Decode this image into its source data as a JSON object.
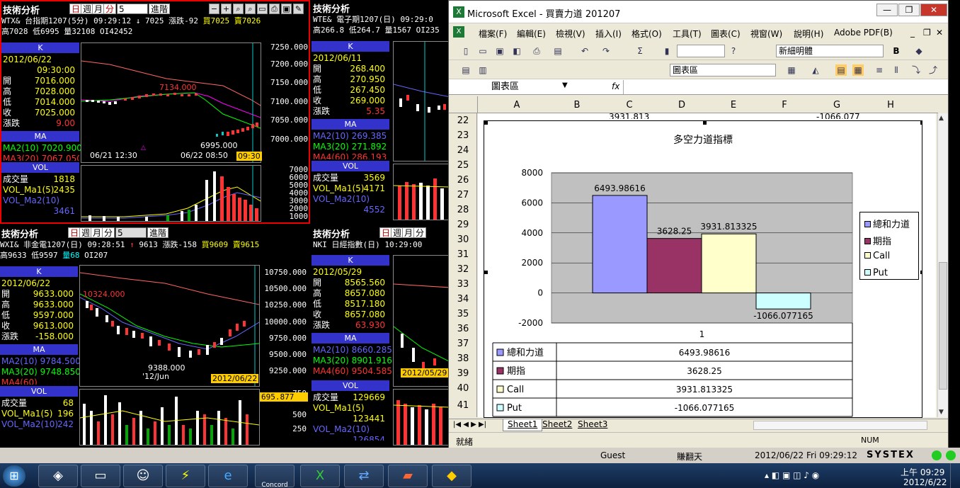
{
  "panels": [
    {
      "title": "技術分析",
      "symbol": "WTX&",
      "name": "台指期1207(5分)",
      "time": "09:29:12",
      "arrow": "↓",
      "price": "7025",
      "change": "漲跌-92",
      "bid": "買7025",
      "ask": "賣7026",
      "high": "高7028",
      "low": "低6995",
      "vol": "量32108",
      "oi": "OI42452",
      "date": "2012/06/22",
      "clock": "09:30:00",
      "open": "7016.000",
      "hi": "7028.000",
      "lo": "7014.000",
      "close": "7025.000",
      "diff": "9.00",
      "ma1": "MA2(10) 7020.900",
      "ma2": "MA3(20) 7067.050",
      "vol_total": "1818",
      "vma1": "2435",
      "vma2": "3461",
      "scale": [
        "7250.000",
        "7200.000",
        "7150.000",
        "7100.000",
        "7050.000",
        "7000.000"
      ],
      "vscale": [
        "7000",
        "6000",
        "5000",
        "4000",
        "3000",
        "2000",
        "1000"
      ],
      "ann_hi": "7134.000",
      "ann_lo": "6995.000",
      "x1": "06/21 12:30",
      "x2": "06/22 08:50",
      "xcur": "09:30",
      "period": "5"
    },
    {
      "title": "技術分析",
      "symbol": "WTE&",
      "name": "電子期1207(日)",
      "time": "09:29:0",
      "high": "高266.8",
      "low": "低264.7",
      "vol": "量1567",
      "oi": "OI235",
      "date": "2012/06/11",
      "open": "268.400",
      "hi": "270.950",
      "lo": "267.450",
      "close": "269.000",
      "diff": "5.35",
      "ma1": "MA2(10) 269.385",
      "ma2": "MA3(20) 271.892",
      "ma3": "MA4(60) 286.193",
      "vol_total": "3569",
      "vma1": "4171",
      "vma2": "4552"
    },
    {
      "title": "技術分析",
      "symbol": "WXI&",
      "name": "非金電1207(日)",
      "time": "09:28:51",
      "arrow": "↑",
      "price": "9613",
      "change": "漲跌-158",
      "bid": "買9609",
      "ask": "賣9615",
      "high": "高9633",
      "low": "低9597",
      "vol": "量68",
      "oi": "OI207",
      "date": "2012/06/22",
      "open": "9633.000",
      "hi": "9633.000",
      "lo": "9597.000",
      "close": "9613.000",
      "diff": "-158.000",
      "ma1": "MA2(10) 9784.500",
      "ma2": "MA3(20) 9748.850",
      "ma3": "MA4(60)",
      "vol_total": "68",
      "vma1": "196",
      "vma2": "242",
      "scale": [
        "10750.000",
        "10500.000",
        "10250.000",
        "10000.000",
        "9750.000",
        "9500.000",
        "9250.000"
      ],
      "vscale": [
        "750",
        "695.877",
        "500",
        "250"
      ],
      "ann_hi": "10324.000",
      "ann_lo": "9388.000",
      "x1": "'12/Jun",
      "xcur": "2012/06/22",
      "period": "5"
    },
    {
      "title": "技術分析",
      "symbol": "NKI",
      "name": "日經指數(日)",
      "time": "10:29:00",
      "date": "2012/05/29",
      "open": "8565.560",
      "hi": "8657.080",
      "lo": "8517.180",
      "close": "8657.080",
      "diff": "63.930",
      "ma1": "MA2(10) 8660.285",
      "ma2": "MA3(20) 8901.916",
      "ma3": "MA4(60) 9504.585",
      "vol_total": "129669",
      "vma1": "123441",
      "vma2": "126854",
      "xcur": "2012/05/29"
    }
  ],
  "labels": {
    "day": "日",
    "week": "週",
    "month": "月",
    "min": "分",
    "adv": "進階",
    "k": "K",
    "ma": "MA",
    "vol": "VOL",
    "open": "開",
    "high": "高",
    "low": "低",
    "close": "收",
    "diff": "漲跌",
    "voltotal": "成交量",
    "vma1": "VOL_Ma1(5)",
    "vma2": "VOL_Ma2(10)"
  },
  "excel": {
    "title": "Microsoft Excel - 買賣力道 201207",
    "menu": [
      "檔案(F)",
      "編輯(E)",
      "檢視(V)",
      "插入(I)",
      "格式(O)",
      "工具(T)",
      "圖表(C)",
      "視窗(W)",
      "說明(H)",
      "Adobe PDF(B)"
    ],
    "font": "新細明體",
    "chart_sel": "圖表區",
    "namebox": "圖表區",
    "fx": "fx",
    "cols": [
      "A",
      "B",
      "C",
      "D",
      "E",
      "F",
      "G",
      "H"
    ],
    "rows": [
      "22",
      "23",
      "24",
      "25",
      "26",
      "27",
      "28",
      "29",
      "30",
      "31",
      "32",
      "33",
      "34",
      "35",
      "36",
      "37",
      "38",
      "39",
      "40",
      "41"
    ],
    "hidden_c22": "3931.813",
    "hidden_g22": "-1066.077",
    "tabs": [
      "Sheet1",
      "Sheet2",
      "Sheet3"
    ],
    "status_left": "就緒",
    "status_right": "NUM"
  },
  "chart_data": {
    "type": "bar",
    "title": "多空力道指標",
    "categories": [
      "1"
    ],
    "series": [
      {
        "name": "總和力道",
        "values": [
          6493.98616
        ],
        "color": "#9999ff"
      },
      {
        "name": "期指",
        "values": [
          3628.25
        ],
        "color": "#993366"
      },
      {
        "name": "Call",
        "values": [
          3931.813325
        ],
        "color": "#ffffcc"
      },
      {
        "name": "Put",
        "values": [
          -1066.077165
        ],
        "color": "#ccffff"
      }
    ],
    "value_labels": [
      "6493.98616",
      "3628.25",
      "3931.813325",
      "-1066.077165"
    ],
    "ylim": [
      -2000,
      8000
    ],
    "yticks": [
      "8000",
      "6000",
      "4000",
      "2000",
      "0",
      "-2000"
    ],
    "grid": true,
    "legend": "right",
    "data_table": true
  },
  "bottombar": {
    "guest": "Guest",
    "user": "賺翻天",
    "datetime": "2012/06/22 Fri 09:29:12",
    "brand": "SYSTEX"
  },
  "taskbar": {
    "time": "上午 09:29",
    "date": "2012/6/22",
    "concord": "Concord"
  }
}
